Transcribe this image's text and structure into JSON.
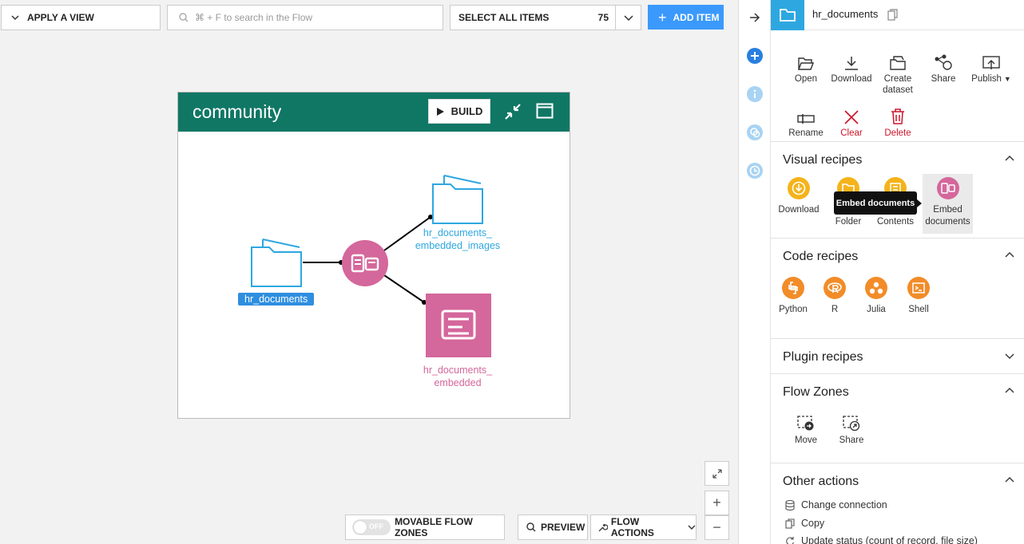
{
  "toolbar": {
    "apply_view": "APPLY A VIEW",
    "search_placeholder": "⌘ + F to search in the Flow",
    "select_all": "SELECT ALL ITEMS",
    "select_count": "75",
    "add_item": "ADD ITEM"
  },
  "zone": {
    "title": "community",
    "build": "BUILD"
  },
  "flow": {
    "source_label": "hr_documents",
    "output_images_label_1": "hr_documents_",
    "output_images_label_2": "embedded_images",
    "output_embedded_label_1": "hr_documents_",
    "output_embedded_label_2": "embedded"
  },
  "bottombar": {
    "toggle_state": "OFF",
    "movable_zones": "MOVABLE FLOW ZONES",
    "preview": "PREVIEW",
    "flow_actions": "FLOW ACTIONS"
  },
  "panel": {
    "dataset_name": "hr_documents",
    "actions": [
      {
        "label": "Open"
      },
      {
        "label": "Download"
      },
      {
        "label": "Create dataset"
      },
      {
        "label": "Share"
      },
      {
        "label": "Publish"
      },
      {
        "label": "Rename"
      },
      {
        "label": "Clear"
      },
      {
        "label": "Delete"
      }
    ],
    "visual_recipes": {
      "title": "Visual recipes",
      "items": [
        {
          "label": "Download"
        },
        {
          "label": "Folder"
        },
        {
          "label": "Contents"
        },
        {
          "label": "Embed documents"
        }
      ],
      "tooltip": "Embed documents"
    },
    "code_recipes": {
      "title": "Code recipes",
      "items": [
        {
          "label": "Python"
        },
        {
          "label": "R"
        },
        {
          "label": "Julia"
        },
        {
          "label": "Shell"
        }
      ]
    },
    "plugin_recipes": {
      "title": "Plugin recipes"
    },
    "flow_zones": {
      "title": "Flow Zones",
      "items": [
        {
          "label": "Move"
        },
        {
          "label": "Share"
        }
      ]
    },
    "other_actions": {
      "title": "Other actions",
      "items": [
        {
          "label": "Change connection"
        },
        {
          "label": "Copy"
        },
        {
          "label": "Update status (count of record, file size)"
        }
      ]
    }
  },
  "colors": {
    "accent": "#3b99fc",
    "zone_header": "#107765",
    "folder": "#2ea7e0",
    "recipe_pink": "#d4679b",
    "visual_orange": "#f5b31a",
    "code_orange": "#f28c28",
    "danger": "#ce1329"
  }
}
